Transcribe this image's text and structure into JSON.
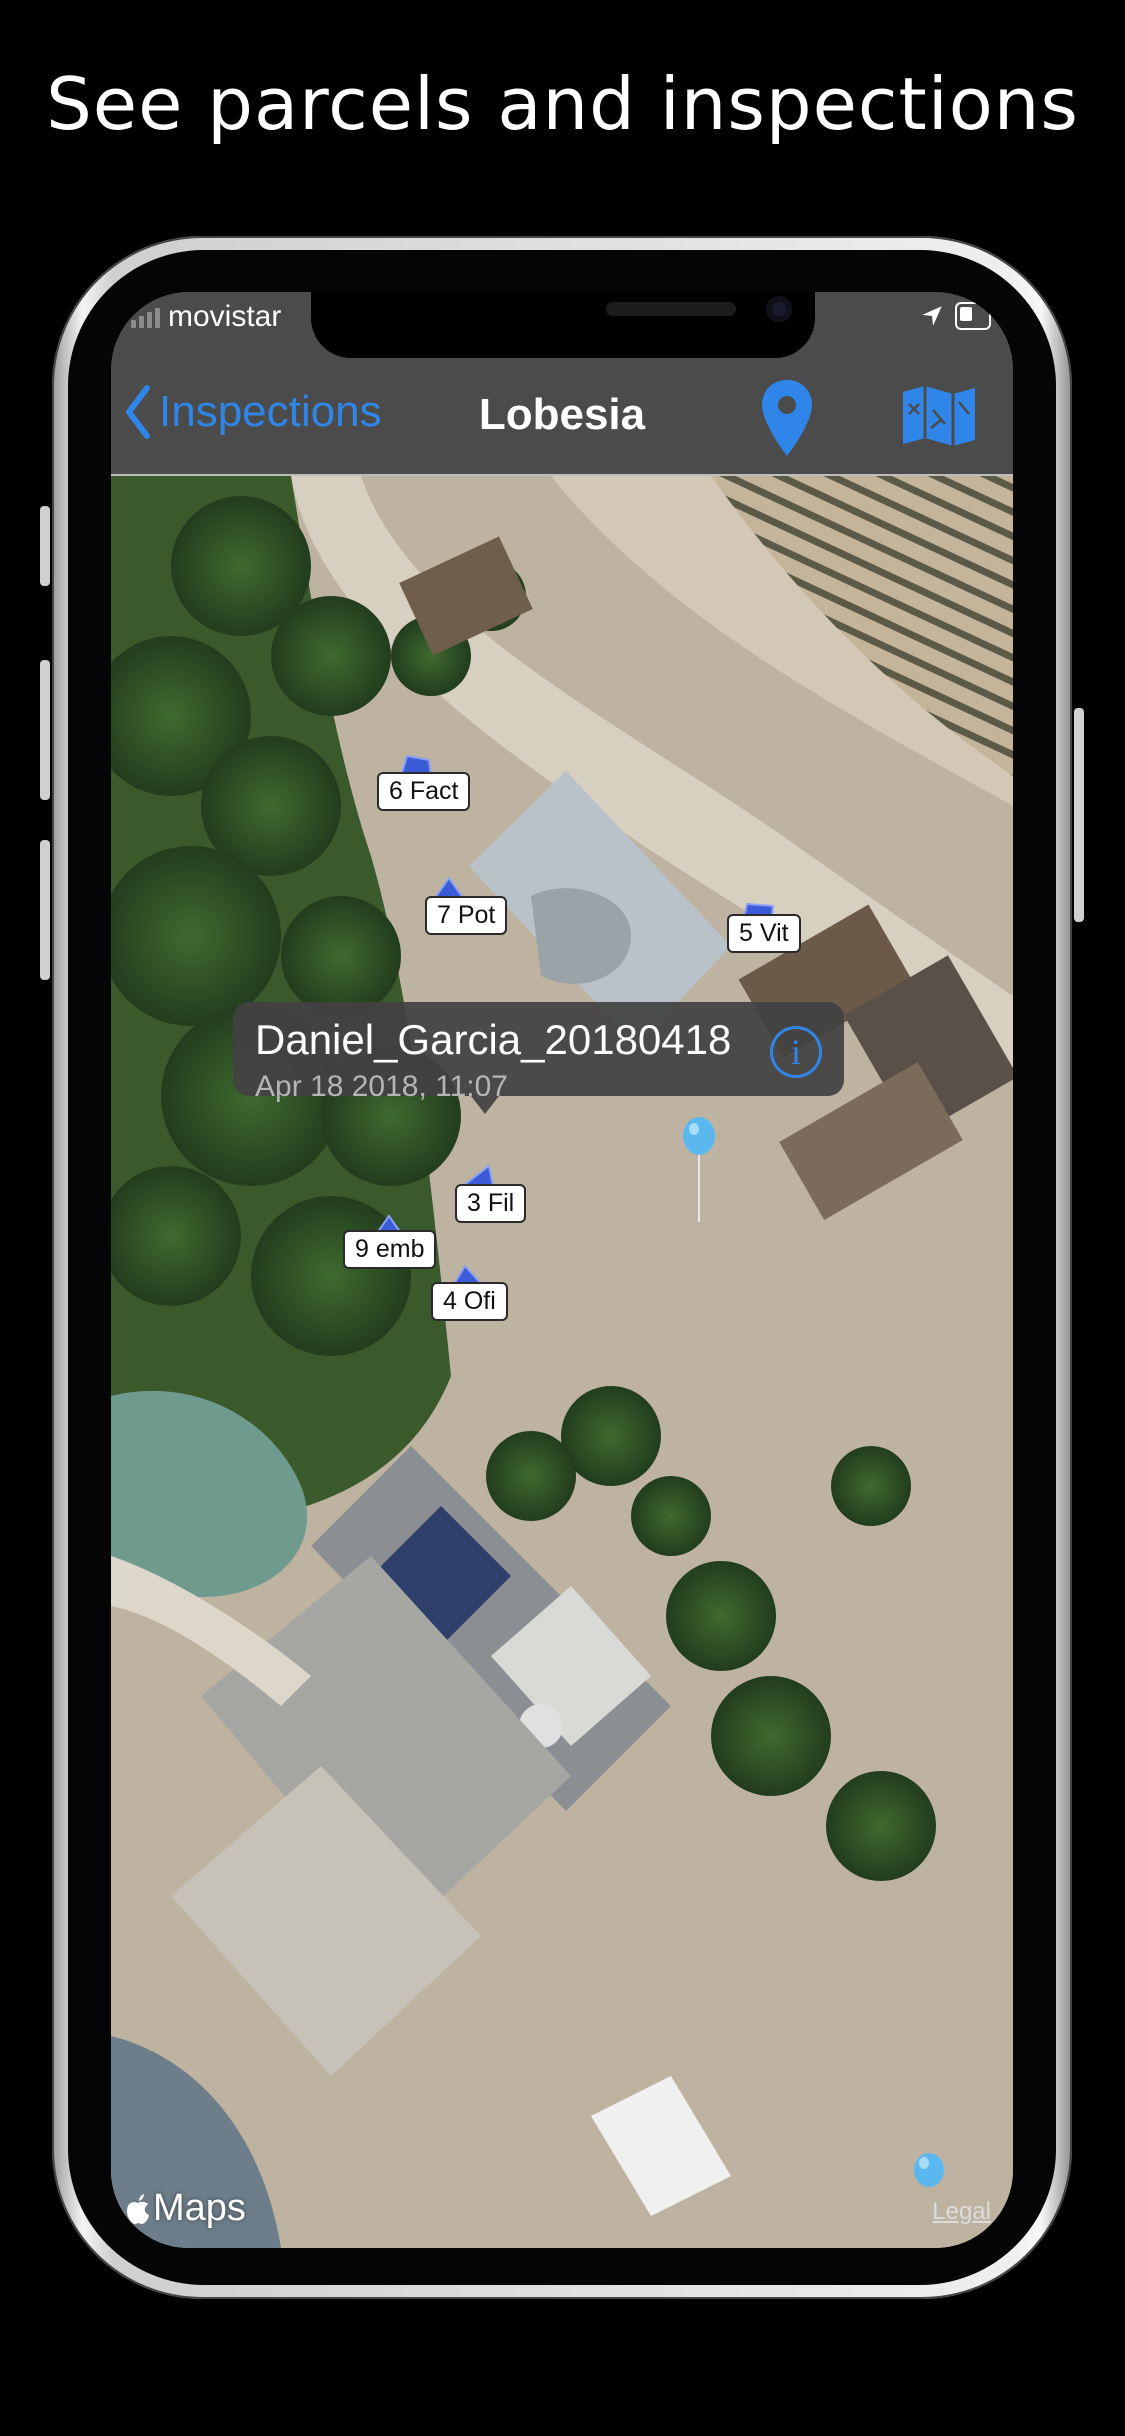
{
  "headline": "See parcels and inspections",
  "status_bar": {
    "carrier": "movistar"
  },
  "nav": {
    "back_label": "Inspections",
    "title": "Lobesia"
  },
  "map": {
    "parcels": [
      {
        "label": "6 Fact"
      },
      {
        "label": "7 Pot"
      },
      {
        "label": "5 Vit"
      },
      {
        "label": "3 Fil"
      },
      {
        "label": "9 emb"
      },
      {
        "label": "4 Ofi"
      }
    ],
    "callout": {
      "title": "Daniel_Garcia_20180418",
      "subtitle": "Apr 18 2018, 11:07"
    },
    "attribution": "Maps",
    "legal": "Legal"
  },
  "colors": {
    "accent": "#2f86e8",
    "bar": "#4b4b4b",
    "pin": "#5ab8ef"
  }
}
